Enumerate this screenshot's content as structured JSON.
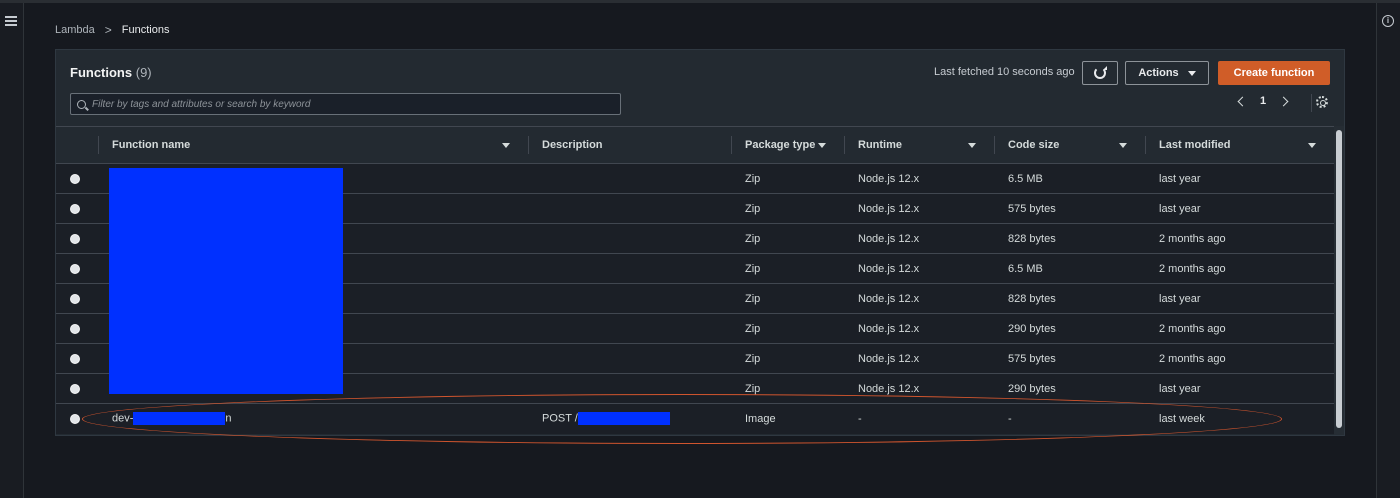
{
  "breadcrumb": {
    "root": "Lambda",
    "current": "Functions"
  },
  "panel": {
    "title": "Functions",
    "count": "(9)",
    "last_fetched": "Last fetched 10 seconds ago",
    "actions_label": "Actions",
    "create_label": "Create function",
    "search_placeholder": "Filter by tags and attributes or search by keyword",
    "page": "1"
  },
  "columns": [
    "Function name",
    "Description",
    "Package type",
    "Runtime",
    "Code size",
    "Last modified"
  ],
  "rows": [
    {
      "name": "",
      "description": "",
      "package": "Zip",
      "runtime": "Node.js 12.x",
      "size": "6.5 MB",
      "modified": "last year"
    },
    {
      "name": "",
      "description": "",
      "package": "Zip",
      "runtime": "Node.js 12.x",
      "size": "575 bytes",
      "modified": "last year"
    },
    {
      "name": "",
      "description": "",
      "package": "Zip",
      "runtime": "Node.js 12.x",
      "size": "828 bytes",
      "modified": "2 months ago"
    },
    {
      "name": "",
      "description": "",
      "package": "Zip",
      "runtime": "Node.js 12.x",
      "size": "6.5 MB",
      "modified": "2 months ago"
    },
    {
      "name": "",
      "description": "",
      "package": "Zip",
      "runtime": "Node.js 12.x",
      "size": "828 bytes",
      "modified": "last year"
    },
    {
      "name": "",
      "description": "",
      "package": "Zip",
      "runtime": "Node.js 12.x",
      "size": "290 bytes",
      "modified": "2 months ago"
    },
    {
      "name": "",
      "description": "",
      "package": "Zip",
      "runtime": "Node.js 12.x",
      "size": "575 bytes",
      "modified": "2 months ago"
    },
    {
      "name": "",
      "description": "",
      "package": "Zip",
      "runtime": "Node.js 12.x",
      "size": "290 bytes",
      "modified": "last year"
    },
    {
      "name_prefix": "dev-",
      "name_suffix": "n",
      "description": "POST /",
      "package": "Image",
      "runtime": "-",
      "size": "-",
      "modified": "last week"
    }
  ],
  "colors": {
    "accent": "#d05d28",
    "redaction": "#0030ff",
    "highlight": "#d0552e"
  },
  "icons": [
    "menu-icon",
    "info-icon",
    "refresh-icon",
    "search-icon",
    "chevron-left-icon",
    "chevron-right-icon",
    "gear-icon"
  ]
}
